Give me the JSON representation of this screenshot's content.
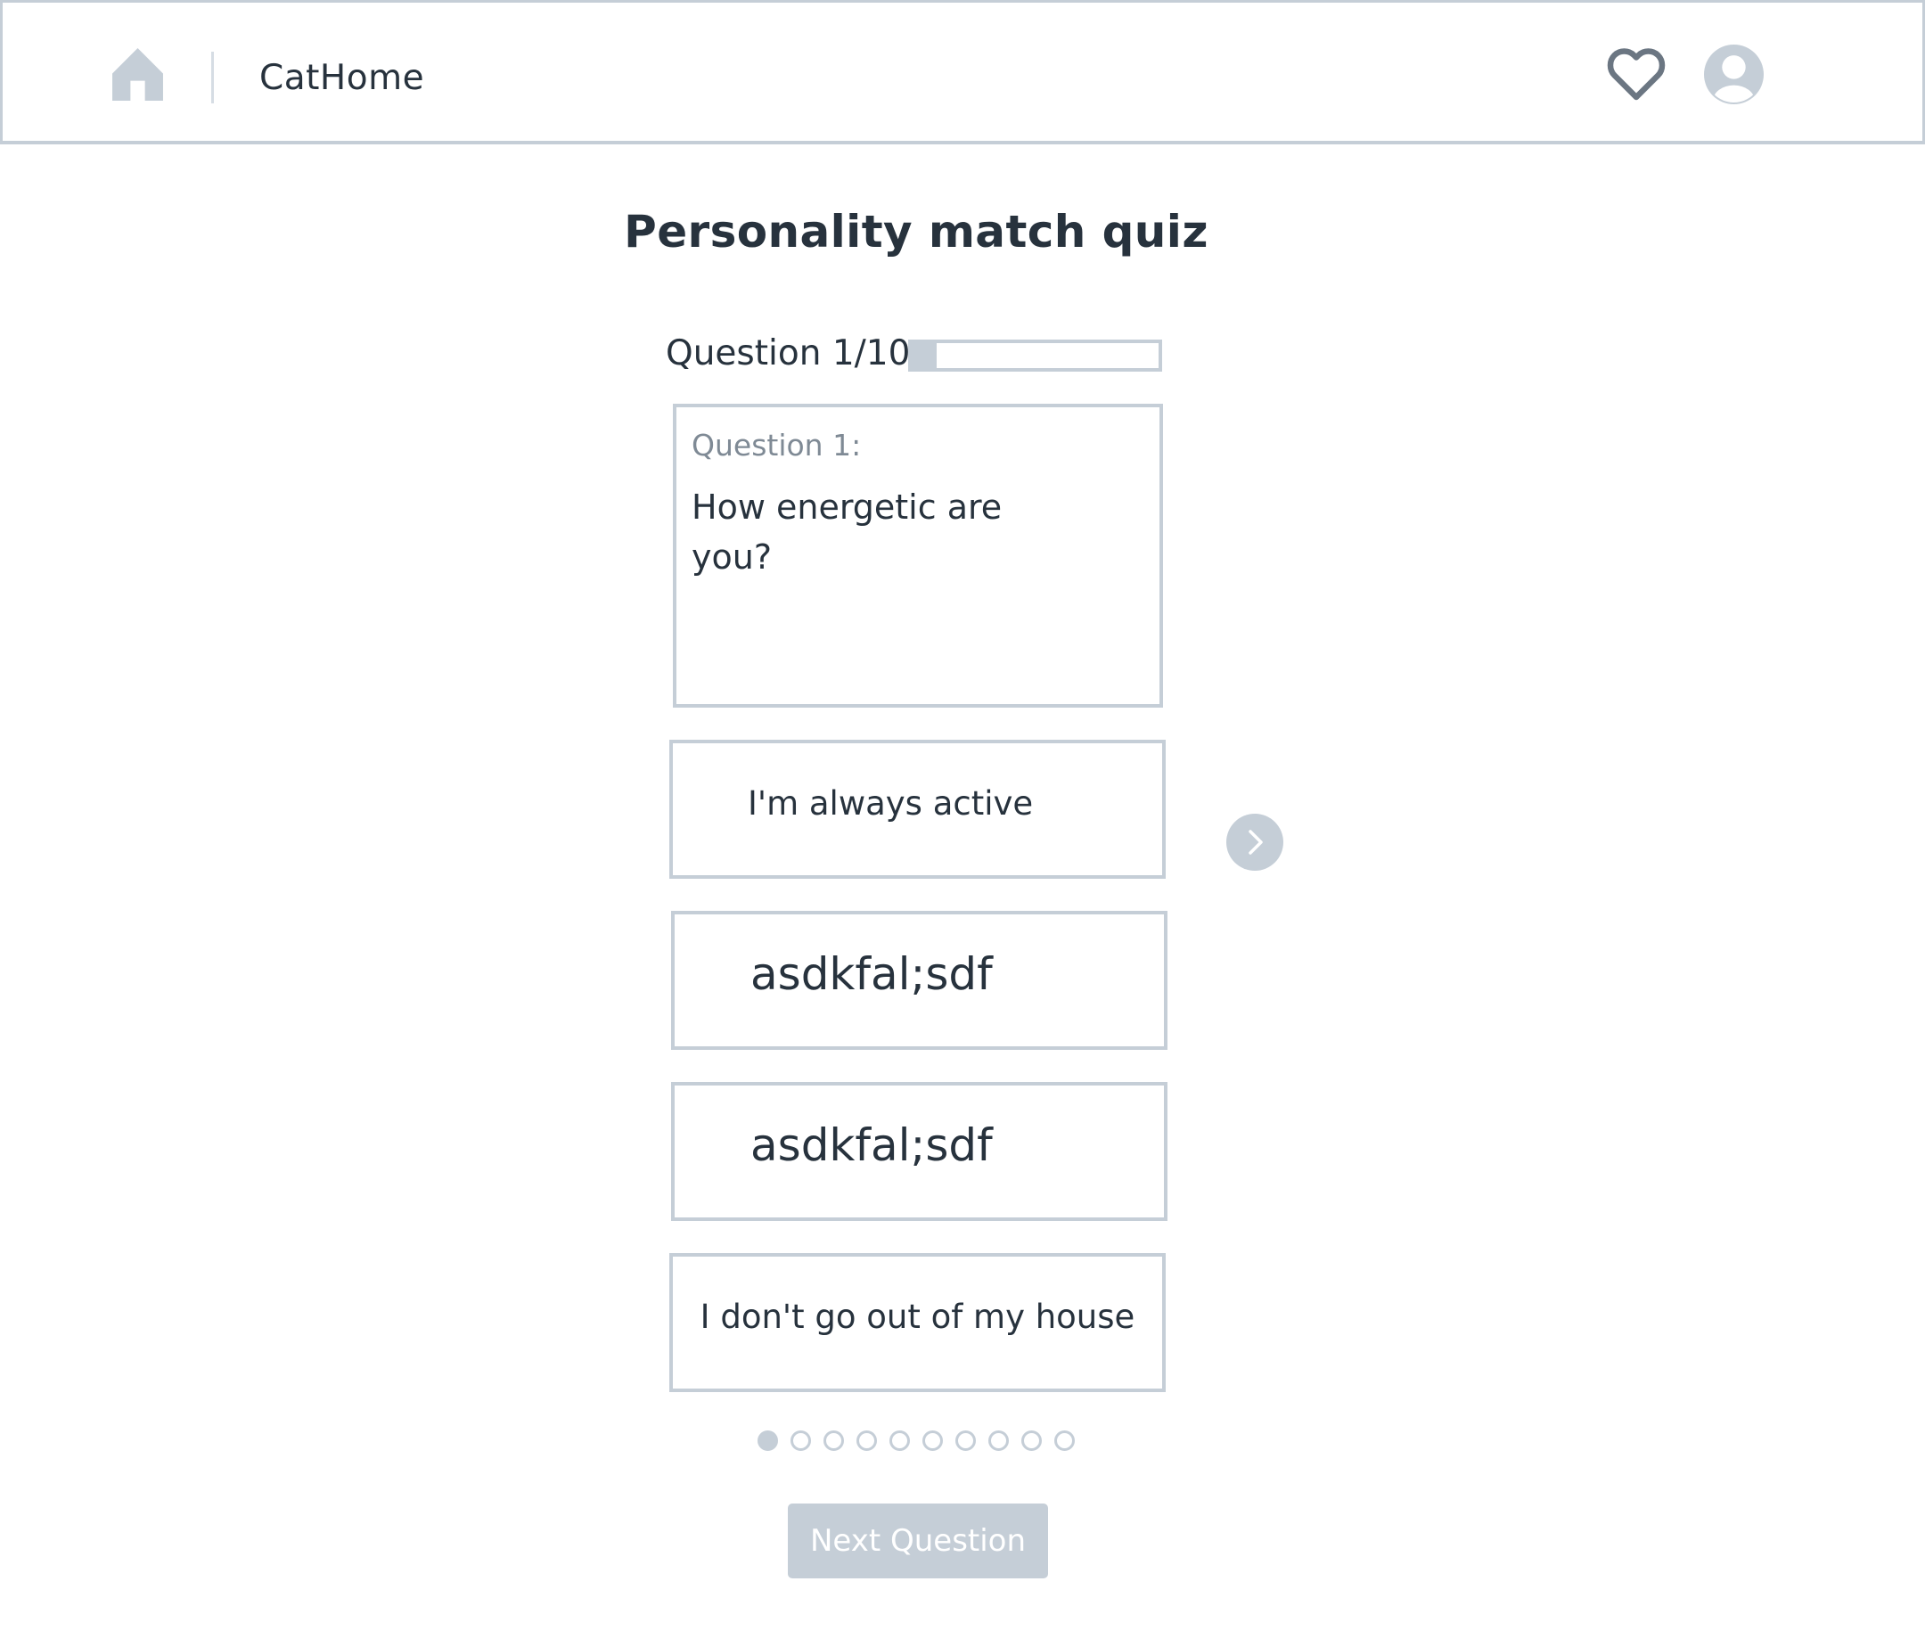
{
  "header": {
    "brand": "CatHome",
    "icons": {
      "home": "home-icon",
      "favorites": "heart-icon",
      "profile": "user-avatar-icon"
    }
  },
  "quiz": {
    "title": "Personality match quiz",
    "progress_label": "Question 1/10",
    "progress_fraction": 0.1,
    "question": {
      "number_label": "Question 1:",
      "text": "How energetic are you?"
    },
    "answers": [
      {
        "label": "I'm always active"
      },
      {
        "label": "asdkfal;sdf"
      },
      {
        "label": "asdkfal;sdf"
      },
      {
        "label": "I don't go out of my house"
      }
    ],
    "pager": {
      "total": 10,
      "current": 1
    },
    "next_button_label": "Next Question"
  },
  "colors": {
    "text": "#27323d",
    "muted_text": "#7f8a95",
    "border": "#c5ced7",
    "accent_gray": "#c5ced7",
    "heart": "#6b7682"
  }
}
